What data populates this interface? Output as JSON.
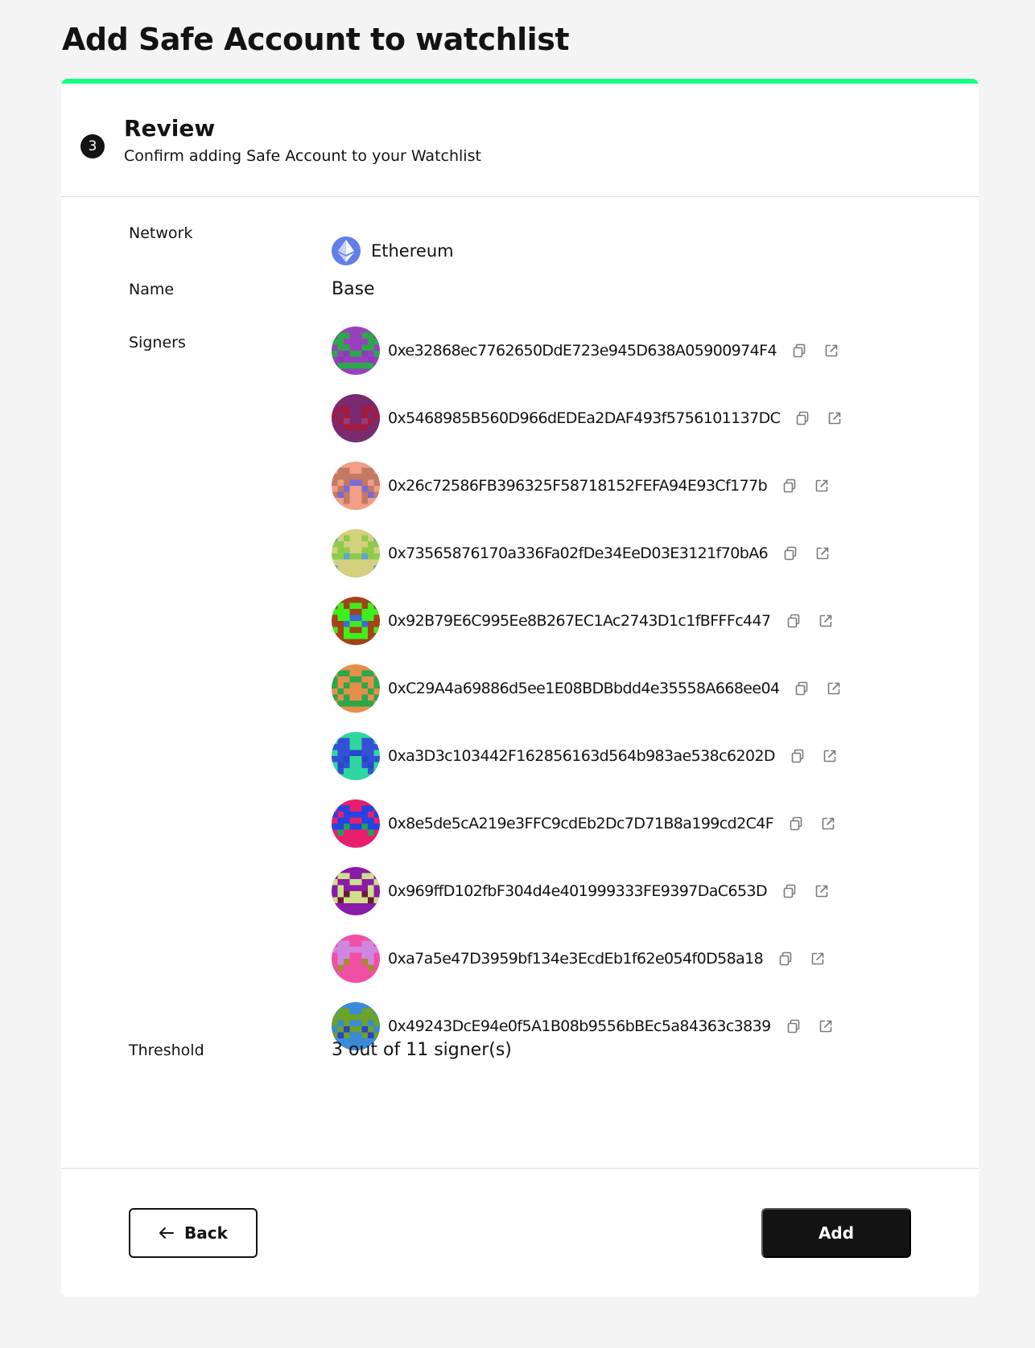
{
  "page": {
    "title": "Add Safe Account to watchlist"
  },
  "step": {
    "number": "3",
    "title": "Review",
    "subtitle": "Confirm adding Safe Account to your Watchlist"
  },
  "fields": {
    "network_label": "Network",
    "network_value": "Ethereum",
    "network_icon": "ethereum-icon",
    "name_label": "Name",
    "name_value": "Base",
    "signers_label": "Signers",
    "threshold_label": "Threshold",
    "threshold_value": "3 out of 11 signer(s)"
  },
  "signers": [
    {
      "address": "0xe32868ec7762650DdE723e945D638A05900974F4",
      "avatar": {
        "bg": "#9a3fbd",
        "fg": "#2aa84a",
        "spot": "#8d3bb6",
        "cells": [
          [
            0,
            1,
            1,
            0
          ],
          [
            1,
            1,
            0,
            0
          ],
          [
            0,
            1,
            1,
            0
          ],
          [
            1,
            0,
            1,
            1
          ],
          [
            0,
            1,
            0,
            0
          ],
          [
            1,
            1,
            1,
            1
          ]
        ]
      }
    },
    {
      "address": "0x5468985B560D966dEDEa2DAF493f5756101137DC",
      "avatar": {
        "bg": "#7a2a6e",
        "fg": "#a31b3d",
        "spot": "#9b3a7a",
        "cells": [
          [
            0,
            0,
            0,
            0
          ],
          [
            0,
            1,
            1,
            0
          ],
          [
            1,
            0,
            1,
            0
          ],
          [
            0,
            1,
            1,
            0
          ],
          [
            0,
            0,
            1,
            1
          ],
          [
            0,
            0,
            0,
            0
          ]
        ]
      }
    },
    {
      "address": "0x26c72586FB396325F58718152FEFA94E93Cf177b",
      "avatar": {
        "bg": "#f09e85",
        "fg": "#c27a63",
        "spot": "#7a6ad8",
        "cells": [
          [
            0,
            1,
            1,
            0
          ],
          [
            1,
            1,
            1,
            1
          ],
          [
            1,
            0,
            1,
            1
          ],
          [
            0,
            1,
            1,
            0
          ],
          [
            1,
            1,
            1,
            0
          ],
          [
            0,
            0,
            1,
            0
          ]
        ]
      }
    },
    {
      "address": "0x73565876170a336Fa02fDe34EeD03E3121f70bA6",
      "avatar": {
        "bg": "#d3d07e",
        "fg": "#8fcb4a",
        "spot": "#5ea3d6",
        "cells": [
          [
            1,
            0,
            1,
            0
          ],
          [
            1,
            1,
            0,
            0
          ],
          [
            0,
            1,
            1,
            0
          ],
          [
            1,
            1,
            1,
            1
          ],
          [
            0,
            0,
            0,
            0
          ],
          [
            1,
            0,
            0,
            0
          ]
        ]
      }
    },
    {
      "address": "0x92B79E6C995Ee8B267EC1Ac2743D1c1fBFFFc447",
      "avatar": {
        "bg": "#a34317",
        "fg": "#3cf01c",
        "spot": "#3b6bd9",
        "cells": [
          [
            0,
            1,
            0,
            1
          ],
          [
            1,
            1,
            1,
            0
          ],
          [
            0,
            1,
            1,
            1
          ],
          [
            0,
            0,
            1,
            1
          ],
          [
            1,
            0,
            1,
            0
          ],
          [
            0,
            0,
            1,
            1
          ]
        ]
      }
    },
    {
      "address": "0xC29A4a69886d5ee1E08BDBbdd4e35558A668ee04",
      "avatar": {
        "bg": "#e88e4c",
        "fg": "#2aa84a",
        "spot": "#2218d8",
        "cells": [
          [
            0,
            1,
            1,
            0
          ],
          [
            1,
            0,
            0,
            1
          ],
          [
            1,
            0,
            1,
            0
          ],
          [
            0,
            1,
            0,
            0
          ],
          [
            1,
            0,
            1,
            0
          ],
          [
            0,
            1,
            1,
            1
          ]
        ]
      }
    },
    {
      "address": "0xa3D3c103442F162856163d564b983ae538c6202D",
      "avatar": {
        "bg": "#2fd6a0",
        "fg": "#3350d6",
        "spot": "#2846c8",
        "cells": [
          [
            0,
            1,
            1,
            0
          ],
          [
            1,
            1,
            1,
            0
          ],
          [
            0,
            1,
            1,
            1
          ],
          [
            1,
            1,
            1,
            0
          ],
          [
            0,
            1,
            1,
            0
          ],
          [
            0,
            1,
            0,
            0
          ]
        ]
      }
    },
    {
      "address": "0x8e5de5cA219e3FFC9cdEb2Dc7D71B8a199cd2C4F",
      "avatar": {
        "bg": "#e81f6e",
        "fg": "#2244e0",
        "spot": "#22a058",
        "cells": [
          [
            0,
            1,
            1,
            0
          ],
          [
            1,
            0,
            1,
            1
          ],
          [
            0,
            1,
            1,
            0
          ],
          [
            1,
            1,
            1,
            1
          ],
          [
            0,
            1,
            0,
            0
          ],
          [
            0,
            0,
            0,
            0
          ]
        ]
      }
    },
    {
      "address": "0x969ffD102fbF304d4e401999333FE9397DaC653D",
      "avatar": {
        "bg": "#8a1aa8",
        "fg": "#cfe08a",
        "spot": "#6b1a36",
        "cells": [
          [
            0,
            1,
            1,
            0
          ],
          [
            1,
            0,
            0,
            1
          ],
          [
            0,
            1,
            0,
            0
          ],
          [
            0,
            1,
            1,
            1
          ],
          [
            1,
            1,
            1,
            1
          ],
          [
            0,
            0,
            0,
            0
          ]
        ]
      }
    },
    {
      "address": "0xa7a5e47D3959bf134e3EcdEb1f62e054f0D58a18",
      "avatar": {
        "bg": "#f04fa6",
        "fg": "#cf86e0",
        "spot": "#a88a2a",
        "cells": [
          [
            0,
            1,
            1,
            0
          ],
          [
            1,
            1,
            1,
            1
          ],
          [
            0,
            1,
            1,
            0
          ],
          [
            0,
            1,
            1,
            0
          ],
          [
            0,
            1,
            0,
            0
          ],
          [
            0,
            0,
            0,
            0
          ]
        ]
      }
    },
    {
      "address": "0x49243DcE94e0f5A1B08b9556bBEc5a84363c3839",
      "avatar": {
        "bg": "#3a8ad6",
        "fg": "#6aa22a",
        "spot": "#2f3fd0",
        "cells": [
          [
            0,
            1,
            1,
            0
          ],
          [
            1,
            1,
            1,
            1
          ],
          [
            1,
            0,
            1,
            0
          ],
          [
            0,
            1,
            1,
            1
          ],
          [
            1,
            1,
            1,
            0
          ],
          [
            0,
            0,
            0,
            0
          ]
        ]
      }
    }
  ],
  "signer_icons": {
    "copy": "copy-icon",
    "explorer": "external-link-icon"
  },
  "actions": {
    "back_label": "Back",
    "add_label": "Add"
  },
  "colors": {
    "accent": "#12ff80",
    "primary": "#121312",
    "ethereum": "#627eea"
  }
}
